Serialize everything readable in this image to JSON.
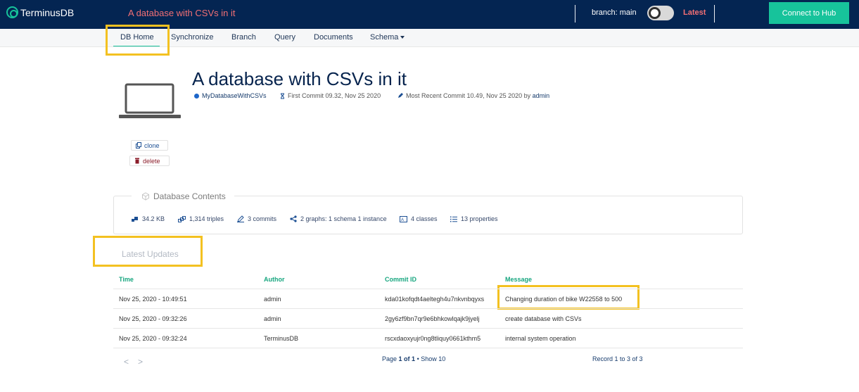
{
  "topbar": {
    "logo_text": "TerminusDB",
    "db_title": "A database with CSVs in it",
    "branch_label": "branch: main",
    "latest_label": "Latest",
    "connect_button": "Connect to Hub"
  },
  "nav": {
    "items": [
      "DB Home",
      "Synchronize",
      "Branch",
      "Query",
      "Documents",
      "Schema"
    ],
    "active": "DB Home"
  },
  "header": {
    "title": "A database with CSVs in it",
    "db_id": "MyDatabaseWithCSVs",
    "first_commit_label": "First Commit",
    "first_commit_value": "09.32, Nov 25 2020",
    "recent_commit_label": "Most Recent Commit",
    "recent_commit_value": "10.49, Nov 25 2020",
    "by_label": "by",
    "author": "admin"
  },
  "actions": {
    "clone": "clone",
    "delete": "delete"
  },
  "contents": {
    "title": "Database Contents",
    "stats": [
      {
        "icon": "size-icon",
        "text": "34.2 KB"
      },
      {
        "icon": "triples-icon",
        "text": "1,314 triples"
      },
      {
        "icon": "pencil-icon",
        "text": "3 commits"
      },
      {
        "icon": "share-graph-icon",
        "text": "2 graphs: 1 schema 1 instance"
      },
      {
        "icon": "classes-icon",
        "text": "4 classes"
      },
      {
        "icon": "list-icon",
        "text": "13 properties"
      }
    ]
  },
  "updates": {
    "title": "Latest Updates",
    "columns": [
      "Time",
      "Author",
      "Commit ID",
      "Message"
    ],
    "rows": [
      [
        "Nov 25, 2020 - 10:49:51",
        "admin",
        "kda01kofqdt4aeltegh4u7nkvnbqyxs",
        "Changing duration of bike W22558 to 500"
      ],
      [
        "Nov 25, 2020 - 09:32:26",
        "admin",
        "2gy6zf9bn7qr9e6bhkowlqajk9jyelj",
        "create database with CSVs"
      ],
      [
        "Nov 25, 2020 - 09:32:24",
        "TerminusDB",
        "rscxdaoxyujr0ng8tliquy0661kthm5",
        "internal system operation"
      ]
    ],
    "pager": {
      "prev": "<",
      "next": ">",
      "page_label": "Page",
      "page_current": "1 of 1",
      "separator": "•",
      "show_label": "Show 10",
      "record_info": "Record 1 to 3 of 3"
    }
  },
  "colors": {
    "topbar_bg": "#042552",
    "accent_green": "#17c39b",
    "accent_red": "#f26f74",
    "highlight": "#f3c121"
  }
}
